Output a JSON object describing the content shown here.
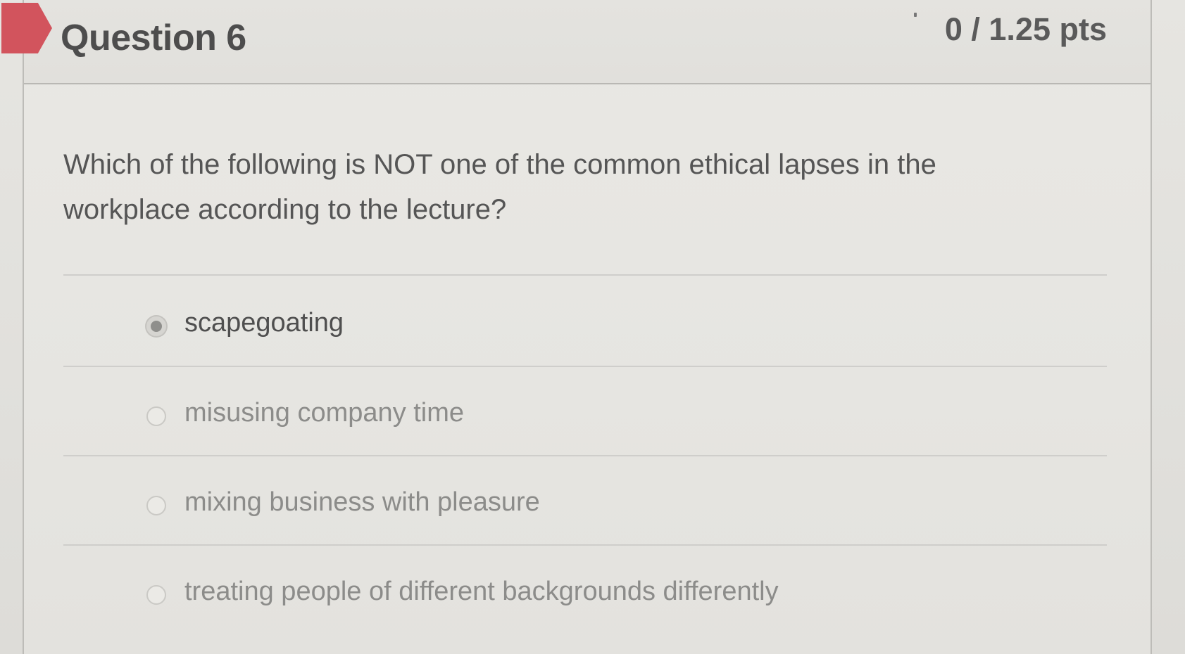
{
  "question": {
    "title": "Question 6",
    "points": "0 / 1.25 pts",
    "prompt": "Which of the following is NOT one of the common ethical lapses in the workplace according to the lecture?",
    "answers": [
      {
        "label": "scapegoating",
        "selected": true
      },
      {
        "label": "misusing company time",
        "selected": false
      },
      {
        "label": "mixing business with pleasure",
        "selected": false
      },
      {
        "label": "treating people of different backgrounds differently",
        "selected": false
      }
    ]
  },
  "colors": {
    "flag": "#d2545d",
    "background": "#e4e3df",
    "title_text": "#4d4d4d",
    "answer_text": "#8c8c8a"
  }
}
